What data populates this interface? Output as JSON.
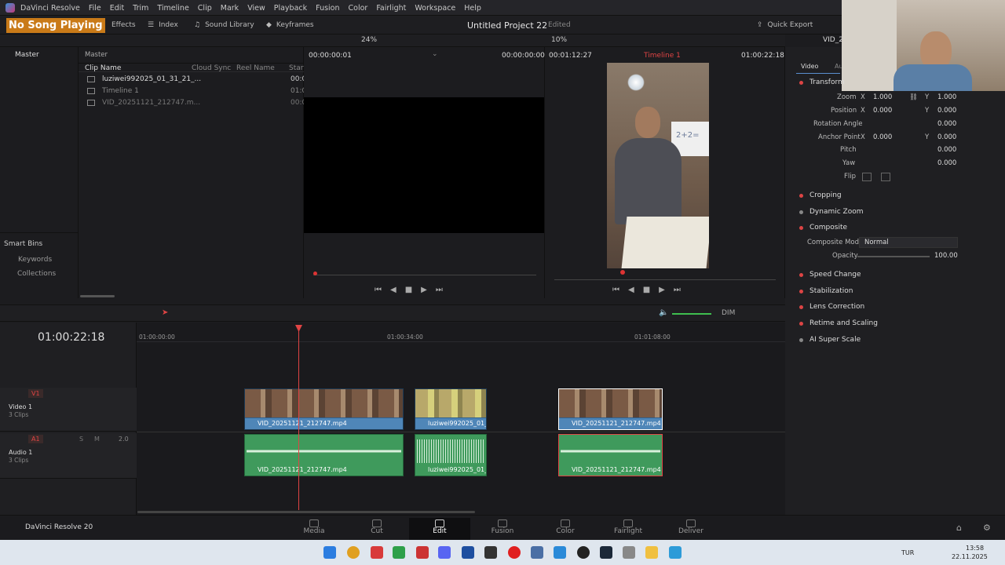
{
  "app": {
    "name": "DaVinci Resolve",
    "project": "Untitled Project 22",
    "status": "Edited",
    "version_label": "DaVinci Resolve 20"
  },
  "menu": [
    "DaVinci Resolve",
    "File",
    "Edit",
    "Trim",
    "Timeline",
    "Clip",
    "Mark",
    "View",
    "Playback",
    "Fusion",
    "Color",
    "Fairlight",
    "Workspace",
    "Help"
  ],
  "overlay": "No Song Playing",
  "toolbar": {
    "effects": "Effects",
    "index": "Index",
    "sound_library": "Sound Library",
    "keyframes": "Keyframes",
    "quick_export": "Quick Export",
    "source_zoom": "24%",
    "timeline_zoom": "10%",
    "clip_title": "VID_2"
  },
  "media_pool": {
    "master": "Master",
    "breadcrumb": "Master",
    "columns": [
      "Clip Name",
      "Cloud Sync",
      "Reel Name",
      "Start"
    ],
    "clips": [
      {
        "name": "luziwei992025_01_31_21_...",
        "start": "00:0"
      },
      {
        "name": "Timeline 1",
        "start": "01:0"
      },
      {
        "name": "VID_20251121_212747.m...",
        "start": "00:0"
      }
    ],
    "smart_bins": "Smart Bins",
    "keywords": "Keywords",
    "collections": "Collections"
  },
  "source_viewer": {
    "tc_left": "00:00:00:01",
    "tc_right": "00:00:00:00"
  },
  "timeline_viewer": {
    "tc_left": "00:01:12:27",
    "timeline_name": "Timeline 1",
    "tc_right": "01:00:22:18",
    "whiteboard_text": "2+2="
  },
  "inspector": {
    "tab_video": "Video",
    "tab_audio": "Au",
    "transform": "Transform",
    "zoom_label": "Zoom",
    "zoom_x": "1.000",
    "zoom_y": "1.000",
    "position_label": "Position",
    "pos_x": "0.000",
    "pos_y": "0.000",
    "rotation_label": "Rotation Angle",
    "rotation": "0.000",
    "anchor_label": "Anchor Point",
    "anchor_x": "0.000",
    "anchor_y": "0.000",
    "pitch_label": "Pitch",
    "pitch": "0.000",
    "yaw_label": "Yaw",
    "yaw": "0.000",
    "flip_label": "Flip",
    "x": "X",
    "y": "Y",
    "cropping": "Cropping",
    "dynamic_zoom": "Dynamic Zoom",
    "composite": "Composite",
    "composite_mode_label": "Composite Mode",
    "composite_mode": "Normal",
    "opacity_label": "Opacity",
    "opacity": "100.00",
    "speed_change": "Speed Change",
    "stabilization": "Stabilization",
    "lens_correction": "Lens Correction",
    "retime": "Retime and Scaling",
    "ai_super_scale": "AI Super Scale"
  },
  "timeline": {
    "timecode": "01:00:22:18",
    "ruler": [
      "01:00:00:00",
      "01:00:34:00",
      "01:01:08:00"
    ],
    "dim": "DIM",
    "v1": "V1",
    "video_track": "Video 1",
    "video_clips": "3 Clips",
    "a1": "A1",
    "audio_track": "Audio 1",
    "audio_clips": "3 Clips",
    "audio_level": "2.0",
    "solo": "S",
    "mute": "M",
    "clips": [
      {
        "name": "VID_20251121_212747.mp4"
      },
      {
        "name": "luziwei992025_01_3..."
      },
      {
        "name": "VID_20251121_212747.mp4"
      }
    ]
  },
  "pages": [
    "Media",
    "Cut",
    "Edit",
    "Fusion",
    "Color",
    "Fairlight",
    "Deliver"
  ],
  "taskbar": {
    "lang": "TUR",
    "time": "13:58",
    "date": "22.11.2025"
  }
}
